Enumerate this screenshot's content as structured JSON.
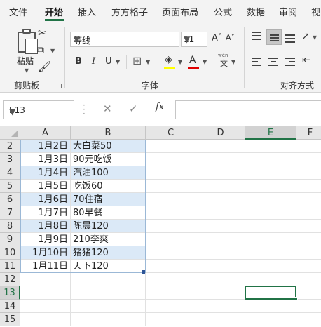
{
  "tabs": [
    "文件",
    "开始",
    "插入",
    "方方格子",
    "页面布局",
    "公式",
    "数据",
    "审阅",
    "视"
  ],
  "active_tab_index": 1,
  "ribbon": {
    "clipboard": {
      "paste_label": "粘贴",
      "group_label": "剪贴板"
    },
    "font": {
      "font_name": "等线",
      "font_size": "11",
      "bold": "B",
      "italic": "I",
      "underline": "U",
      "grow": "A˄",
      "shrink": "A˅",
      "font_color_glyph": "A",
      "phonetic_top": "wén",
      "phonetic_bottom": "文",
      "group_label": "字体",
      "highlight_color": "#ffff00",
      "font_color": "#e00000"
    },
    "alignment": {
      "group_label": "对齐方式"
    }
  },
  "formula_bar": {
    "name_box": "E13",
    "fx_label": "fx",
    "formula_value": ""
  },
  "grid": {
    "columns": [
      "A",
      "B",
      "C",
      "D",
      "E",
      "F"
    ],
    "active_column": "E",
    "row_numbers": [
      "2",
      "3",
      "4",
      "5",
      "6",
      "7",
      "8",
      "9",
      "10",
      "11",
      "12",
      "13",
      "14",
      "15"
    ],
    "active_row": "13",
    "rows": [
      {
        "a": "1月2日",
        "b": "大白菜50"
      },
      {
        "a": "1月3日",
        "b": "90元吃饭"
      },
      {
        "a": "1月4日",
        "b": "汽油100"
      },
      {
        "a": "1月5日",
        "b": "吃饭60"
      },
      {
        "a": "1月6日",
        "b": "70住宿"
      },
      {
        "a": "1月7日",
        "b": "80早餐"
      },
      {
        "a": "1月8日",
        "b": "陈晨120"
      },
      {
        "a": "1月9日",
        "b": "210李爽"
      },
      {
        "a": "1月10日",
        "b": "猪猪120"
      },
      {
        "a": "1月11日",
        "b": "天下120"
      }
    ],
    "band_color": "#dbe9f7",
    "accent_color": "#217346"
  }
}
